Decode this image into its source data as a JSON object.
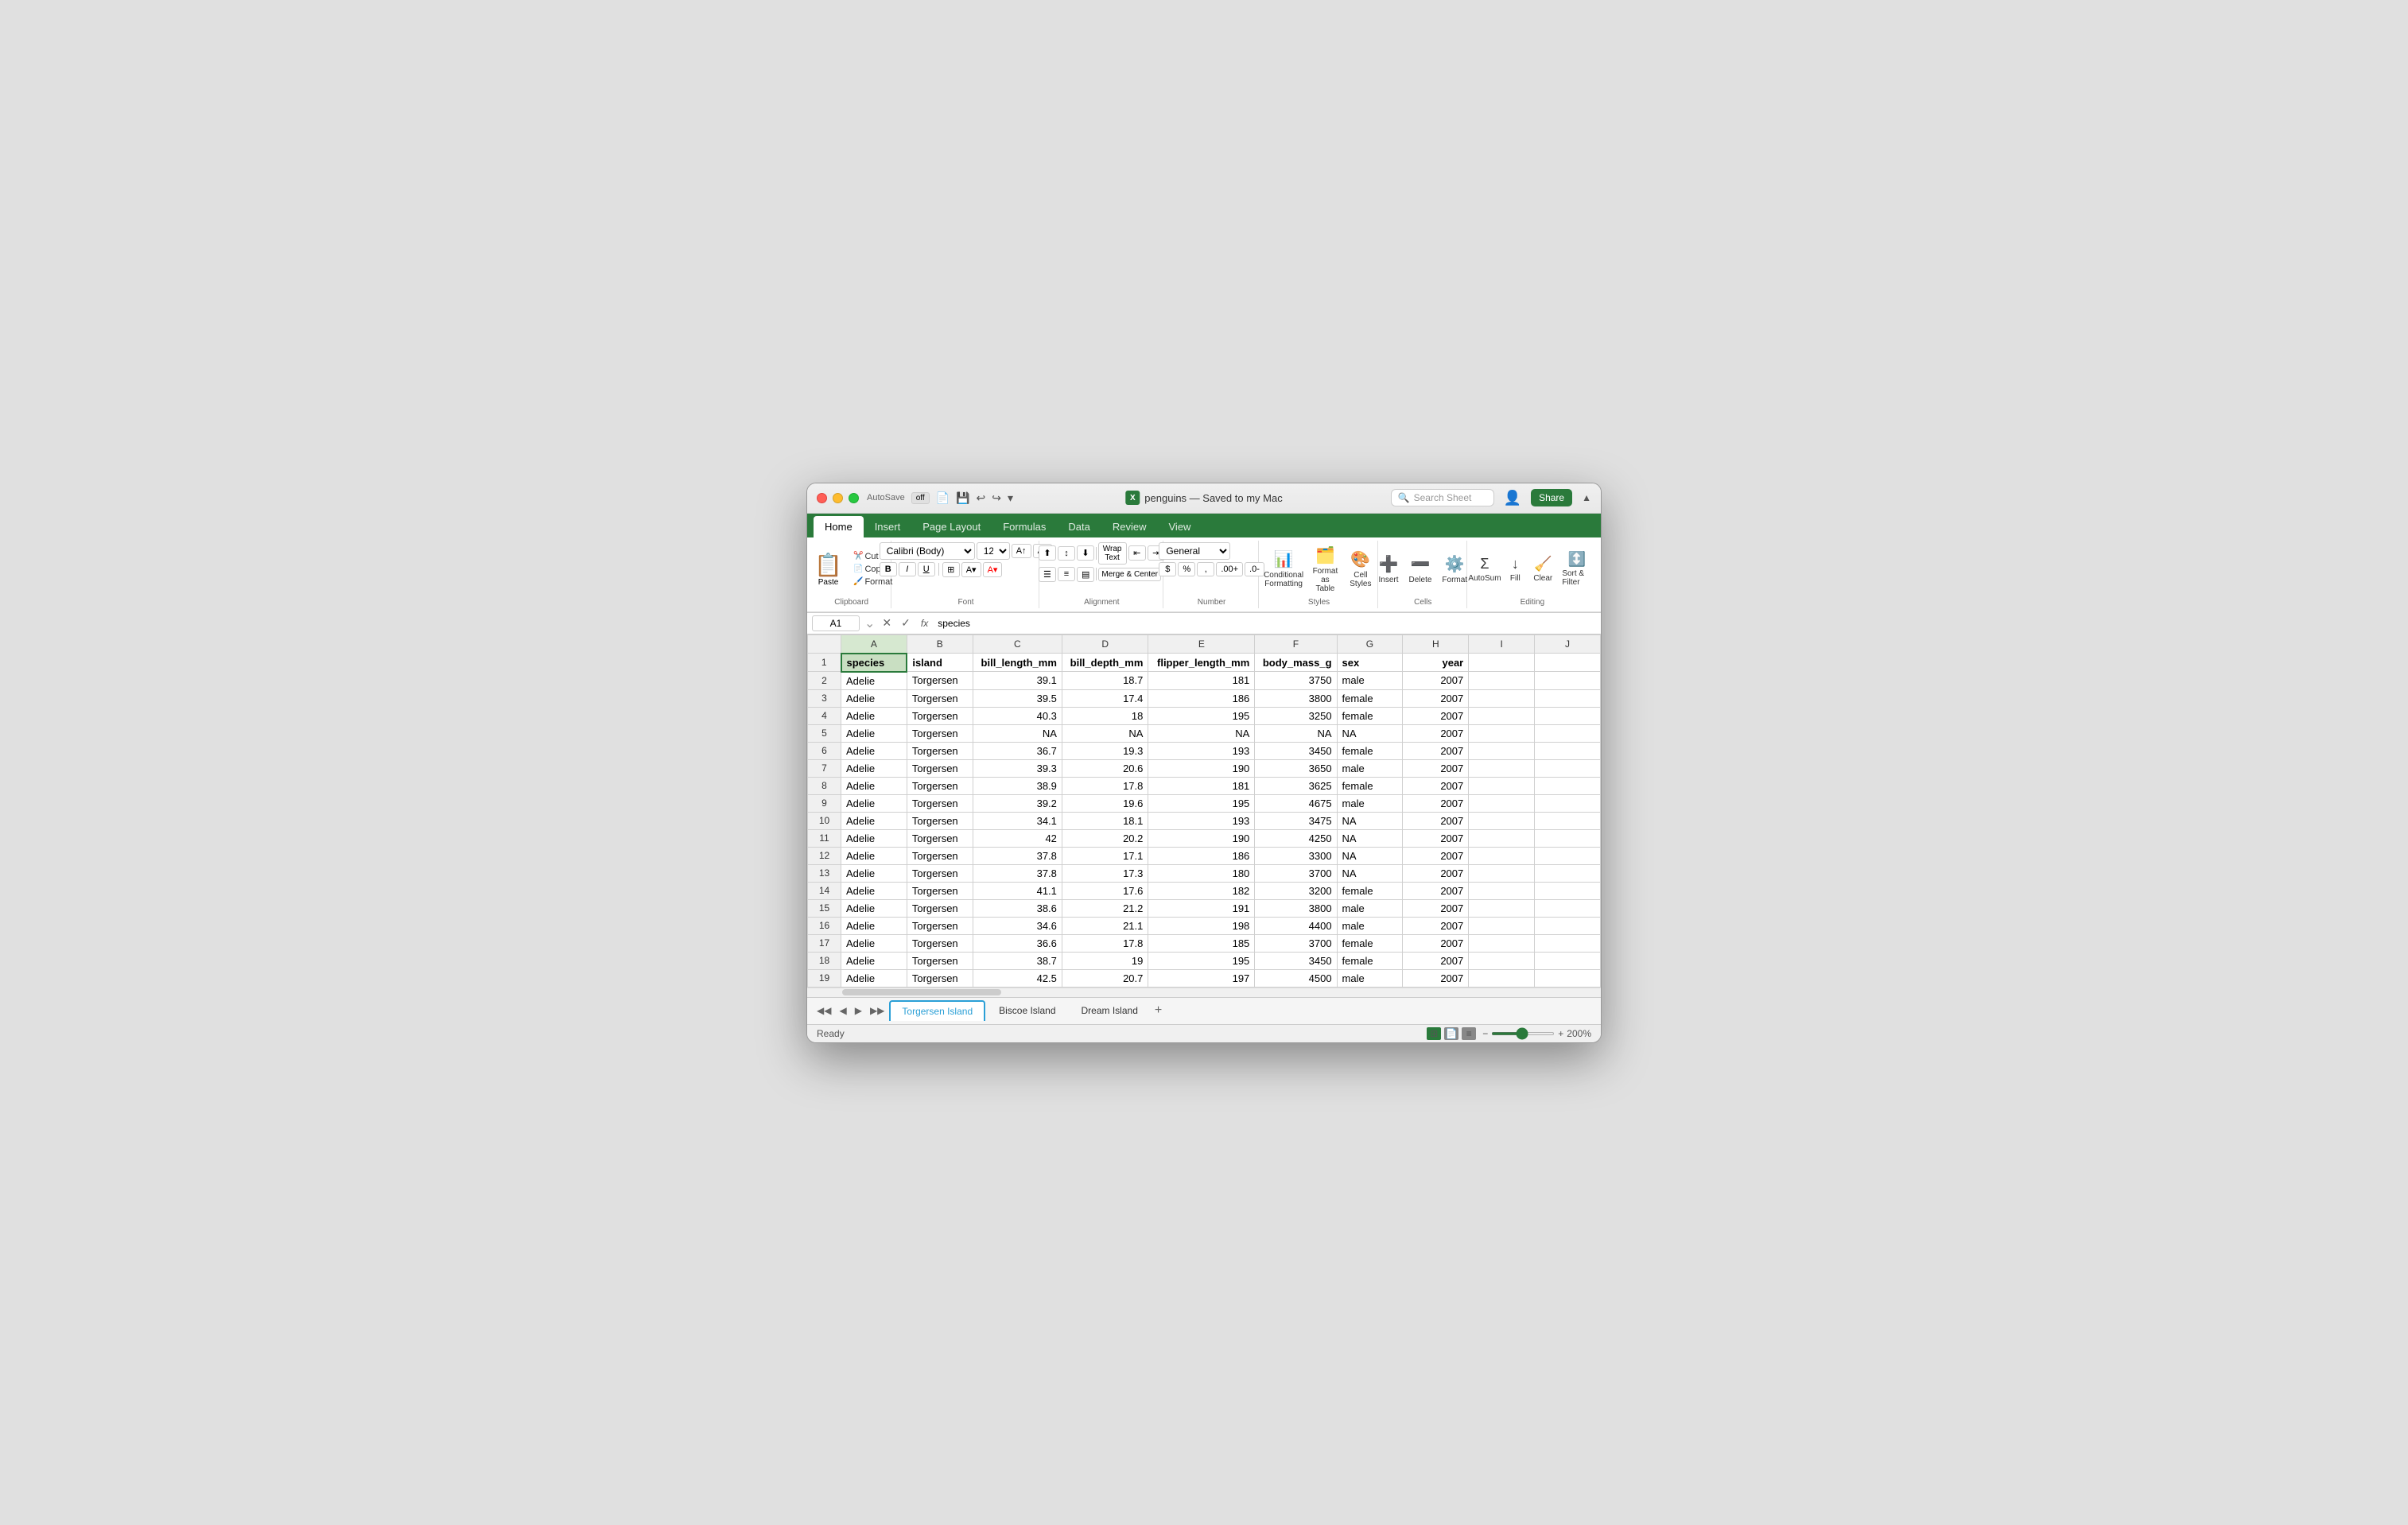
{
  "window": {
    "title": "penguins — Saved to my Mac",
    "icon_label": "X"
  },
  "titlebar": {
    "autosave_label": "AutoSave",
    "autosave_state": "off",
    "search_placeholder": "Search Sheet",
    "share_label": "Share"
  },
  "ribbon": {
    "tabs": [
      "Home",
      "Insert",
      "Page Layout",
      "Formulas",
      "Data",
      "Review",
      "View"
    ],
    "active_tab": "Home",
    "clipboard": {
      "paste_label": "Paste",
      "cut_label": "Cut",
      "copy_label": "Copy",
      "format_label": "Format"
    },
    "font": {
      "family": "Calibri (Body)",
      "size": "12",
      "bold_label": "B",
      "italic_label": "I",
      "underline_label": "U"
    },
    "alignment": {
      "wrap_text_label": "Wrap Text",
      "merge_center_label": "Merge & Center"
    },
    "number": {
      "format_label": "General"
    },
    "styles": {
      "conditional_formatting_label": "Conditional Formatting",
      "format_as_table_label": "Format as Table",
      "cell_styles_label": "Cell Styles"
    },
    "cells": {
      "insert_label": "Insert",
      "delete_label": "Delete",
      "format_label": "Format"
    },
    "editing": {
      "autosum_label": "AutoSum",
      "fill_label": "Fill",
      "clear_label": "Clear",
      "sort_filter_label": "Sort & Filter"
    }
  },
  "formula_bar": {
    "cell_ref": "A1",
    "formula": "species"
  },
  "columns": {
    "headers": [
      "",
      "A",
      "B",
      "C",
      "D",
      "E",
      "F",
      "G",
      "H",
      "I",
      "J"
    ]
  },
  "data": {
    "headers": [
      "species",
      "island",
      "bill_length_mm",
      "bill_depth_mm",
      "flipper_length_mm",
      "body_mass_g",
      "sex",
      "year"
    ],
    "rows": [
      [
        2,
        "Adelie",
        "Torgersen",
        "39.1",
        "18.7",
        "181",
        "3750",
        "male",
        "2007"
      ],
      [
        3,
        "Adelie",
        "Torgersen",
        "39.5",
        "17.4",
        "186",
        "3800",
        "female",
        "2007"
      ],
      [
        4,
        "Adelie",
        "Torgersen",
        "40.3",
        "18",
        "195",
        "3250",
        "female",
        "2007"
      ],
      [
        5,
        "Adelie",
        "Torgersen",
        "NA",
        "NA",
        "NA",
        "NA",
        "NA",
        "2007"
      ],
      [
        6,
        "Adelie",
        "Torgersen",
        "36.7",
        "19.3",
        "193",
        "3450",
        "female",
        "2007"
      ],
      [
        7,
        "Adelie",
        "Torgersen",
        "39.3",
        "20.6",
        "190",
        "3650",
        "male",
        "2007"
      ],
      [
        8,
        "Adelie",
        "Torgersen",
        "38.9",
        "17.8",
        "181",
        "3625",
        "female",
        "2007"
      ],
      [
        9,
        "Adelie",
        "Torgersen",
        "39.2",
        "19.6",
        "195",
        "4675",
        "male",
        "2007"
      ],
      [
        10,
        "Adelie",
        "Torgersen",
        "34.1",
        "18.1",
        "193",
        "3475",
        "NA",
        "2007"
      ],
      [
        11,
        "Adelie",
        "Torgersen",
        "42",
        "20.2",
        "190",
        "4250",
        "NA",
        "2007"
      ],
      [
        12,
        "Adelie",
        "Torgersen",
        "37.8",
        "17.1",
        "186",
        "3300",
        "NA",
        "2007"
      ],
      [
        13,
        "Adelie",
        "Torgersen",
        "37.8",
        "17.3",
        "180",
        "3700",
        "NA",
        "2007"
      ],
      [
        14,
        "Adelie",
        "Torgersen",
        "41.1",
        "17.6",
        "182",
        "3200",
        "female",
        "2007"
      ],
      [
        15,
        "Adelie",
        "Torgersen",
        "38.6",
        "21.2",
        "191",
        "3800",
        "male",
        "2007"
      ],
      [
        16,
        "Adelie",
        "Torgersen",
        "34.6",
        "21.1",
        "198",
        "4400",
        "male",
        "2007"
      ],
      [
        17,
        "Adelie",
        "Torgersen",
        "36.6",
        "17.8",
        "185",
        "3700",
        "female",
        "2007"
      ],
      [
        18,
        "Adelie",
        "Torgersen",
        "38.7",
        "19",
        "195",
        "3450",
        "female",
        "2007"
      ],
      [
        19,
        "Adelie",
        "Torgersen",
        "42.5",
        "20.7",
        "197",
        "4500",
        "male",
        "2007"
      ]
    ]
  },
  "sheets": [
    {
      "label": "Torgersen Island",
      "active": true
    },
    {
      "label": "Biscoe Island",
      "active": false
    },
    {
      "label": "Dream Island",
      "active": false
    }
  ],
  "status": {
    "ready_label": "Ready",
    "zoom": "200%"
  }
}
